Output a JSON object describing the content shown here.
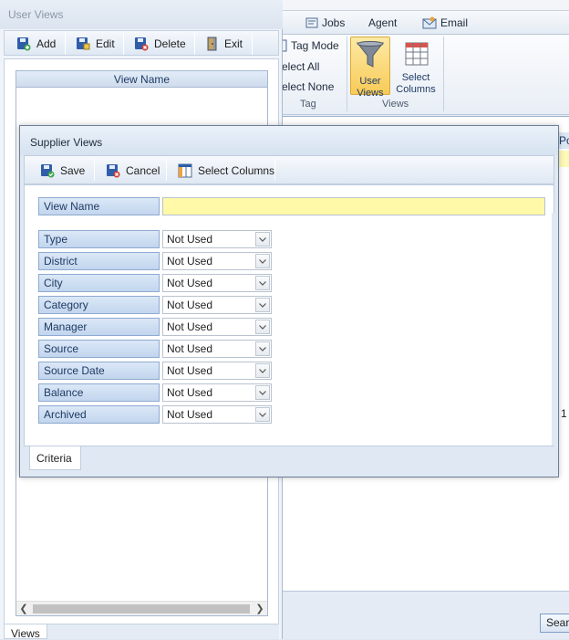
{
  "main_ribbon": {
    "tabs": [
      {
        "label": "Jobs",
        "icon": "jobs-icon"
      },
      {
        "label": "Agent",
        "icon": ""
      },
      {
        "label": "Email",
        "icon": "email-icon"
      }
    ],
    "tag_group": {
      "items": [
        {
          "label": "Tag Mode",
          "icon": "tag-mode-icon"
        },
        {
          "label": "elect All"
        },
        {
          "label": "elect None"
        }
      ],
      "label": "Tag"
    },
    "views_group": {
      "user_views": "User Views",
      "select_columns": "Select Columns",
      "label": "Views"
    },
    "grid_header_partial": "Po",
    "stray_value": "1",
    "search_button": "Sear"
  },
  "user_views": {
    "title": "User Views",
    "toolbar": {
      "add": "Add",
      "edit": "Edit",
      "delete": "Delete",
      "exit": "Exit"
    },
    "list_header": "View Name",
    "tab": "Views"
  },
  "supplier_views": {
    "title": "Supplier Views",
    "toolbar": {
      "save": "Save",
      "cancel": "Cancel",
      "select_columns": "Select Columns"
    },
    "view_name_label": "View Name",
    "view_name_value": "",
    "criteria": [
      {
        "label": "Type",
        "value": "Not Used"
      },
      {
        "label": "District",
        "value": "Not Used"
      },
      {
        "label": "City",
        "value": "Not Used"
      },
      {
        "label": "Category",
        "value": "Not Used"
      },
      {
        "label": "Manager",
        "value": "Not Used"
      },
      {
        "label": "Source",
        "value": "Not Used"
      },
      {
        "label": "Source Date",
        "value": "Not Used"
      },
      {
        "label": "Balance",
        "value": "Not Used"
      },
      {
        "label": "Archived",
        "value": "Not Used"
      }
    ],
    "tab": "Criteria"
  },
  "colors": {
    "accent_blue": "#1e3a64",
    "label_fill": "#c2d6ee",
    "input_yellow": "#fff9a8",
    "active_button": "#f8cb57"
  }
}
